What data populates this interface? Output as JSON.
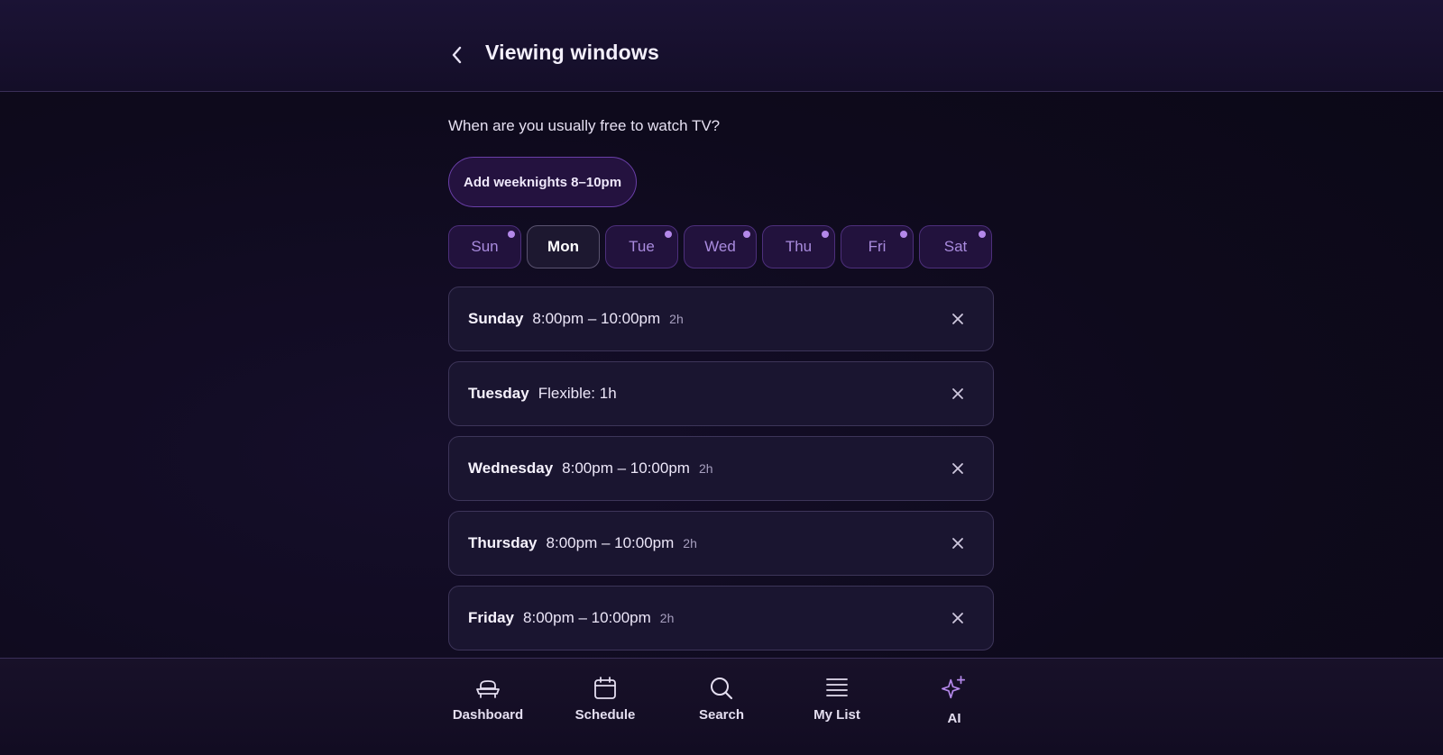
{
  "header": {
    "title": "Viewing windows",
    "back_icon": "chevron-left-icon"
  },
  "main": {
    "question": "When are you usually free to watch TV?",
    "quick_add_label": "Add weeknights 8–10pm",
    "day_chips": [
      {
        "label": "Sun",
        "selected": false,
        "has_window": true
      },
      {
        "label": "Mon",
        "selected": true,
        "has_window": false
      },
      {
        "label": "Tue",
        "selected": false,
        "has_window": true
      },
      {
        "label": "Wed",
        "selected": false,
        "has_window": true
      },
      {
        "label": "Thu",
        "selected": false,
        "has_window": true
      },
      {
        "label": "Fri",
        "selected": false,
        "has_window": true
      },
      {
        "label": "Sat",
        "selected": false,
        "has_window": true
      }
    ],
    "windows": [
      {
        "day": "Sunday",
        "time": "8:00pm – 10:00pm",
        "duration": "2h"
      },
      {
        "day": "Tuesday",
        "time": "Flexible: 1h",
        "duration": ""
      },
      {
        "day": "Wednesday",
        "time": "8:00pm – 10:00pm",
        "duration": "2h"
      },
      {
        "day": "Thursday",
        "time": "8:00pm – 10:00pm",
        "duration": "2h"
      },
      {
        "day": "Friday",
        "time": "8:00pm – 10:00pm",
        "duration": "2h"
      }
    ]
  },
  "bottom_nav": {
    "items": [
      {
        "label": "Dashboard",
        "icon": "couch-icon"
      },
      {
        "label": "Schedule",
        "icon": "calendar-icon"
      },
      {
        "label": "Search",
        "icon": "search-icon"
      },
      {
        "label": "My List",
        "icon": "list-icon"
      },
      {
        "label": "AI",
        "icon": "sparkles-icon",
        "active": true
      }
    ]
  },
  "colors": {
    "background": "#0f0a1e",
    "accent": "#b488ea",
    "chip_active_bg": "#22123d",
    "card_bg": "#1a1530"
  }
}
